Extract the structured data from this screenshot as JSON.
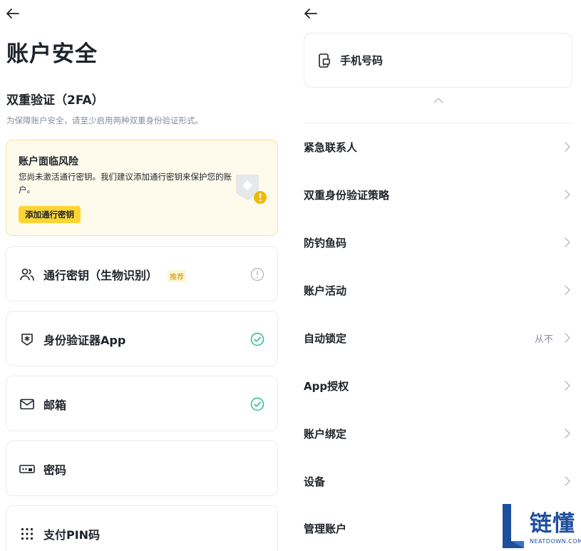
{
  "left": {
    "title": "账户安全",
    "twofa_title": "双重验证（2FA）",
    "twofa_desc": "为保障账户安全，请至少启用两种双重身份验证形式。",
    "risk": {
      "title": "账户面临风险",
      "text": "您尚未激活通行密钥。我们建议添加通行密钥来保护您的账户。",
      "button": "添加通行密钥"
    },
    "methods": [
      {
        "label": "通行密钥（生物识别）",
        "tag": "推荐",
        "icon": "users-icon",
        "status": "warning"
      },
      {
        "label": "身份验证器App",
        "icon": "authenticator-shield-icon",
        "status": "enabled"
      },
      {
        "label": "邮箱",
        "icon": "mail-icon",
        "status": "enabled"
      },
      {
        "label": "密码",
        "icon": "password-icon",
        "status": "none"
      },
      {
        "label": "支付PIN码",
        "icon": "pin-keypad-icon",
        "status": "none"
      }
    ]
  },
  "right": {
    "phone": "手机号码",
    "rows": [
      {
        "label": "紧急联系人"
      },
      {
        "label": "双重身份验证策略"
      },
      {
        "label": "防钓鱼码"
      },
      {
        "label": "账户活动"
      },
      {
        "label": "自动锁定",
        "value": "从不"
      },
      {
        "label": "App授权"
      },
      {
        "label": "账户绑定"
      },
      {
        "label": "设备"
      },
      {
        "label": "管理账户"
      }
    ]
  },
  "watermark": {
    "text": "链懂",
    "sub": "NEATDOWN.COM"
  },
  "colors": {
    "text": "#1e2329",
    "muted": "#848e9c",
    "accent": "#fcd535",
    "success": "#2ebd85",
    "border": "#eaecef",
    "warning_bg": "#fefbec"
  }
}
